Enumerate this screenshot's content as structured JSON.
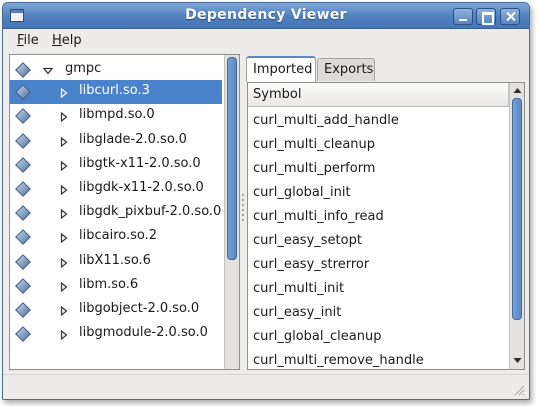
{
  "window": {
    "title": "Dependency Viewer"
  },
  "menu": {
    "file": {
      "mnemonic": "F",
      "rest": "ile"
    },
    "help": {
      "mnemonic": "H",
      "rest": "elp"
    }
  },
  "tree": {
    "root": "gmpc",
    "selected_index": 0,
    "children": [
      "libcurl.so.3",
      "libmpd.so.0",
      "libglade-2.0.so.0",
      "libgtk-x11-2.0.so.0",
      "libgdk-x11-2.0.so.0",
      "libgdk_pixbuf-2.0.so.0",
      "libcairo.so.2",
      "libX11.so.6",
      "libm.so.6",
      "libgobject-2.0.so.0",
      "libgmodule-2.0.so.0"
    ]
  },
  "tabs": {
    "imported": "Imported",
    "exports": "Exports",
    "active": "imported"
  },
  "symbols": {
    "header": "Symbol",
    "rows": [
      "curl_multi_add_handle",
      "curl_multi_cleanup",
      "curl_multi_perform",
      "curl_global_init",
      "curl_multi_info_read",
      "curl_easy_setopt",
      "curl_easy_strerror",
      "curl_multi_init",
      "curl_easy_init",
      "curl_global_cleanup",
      "curl_multi_remove_handle"
    ]
  },
  "colors": {
    "selection": "#4a83c9",
    "titlebar": "#4f7fbd",
    "scroll_thumb": "#5a88c6"
  }
}
